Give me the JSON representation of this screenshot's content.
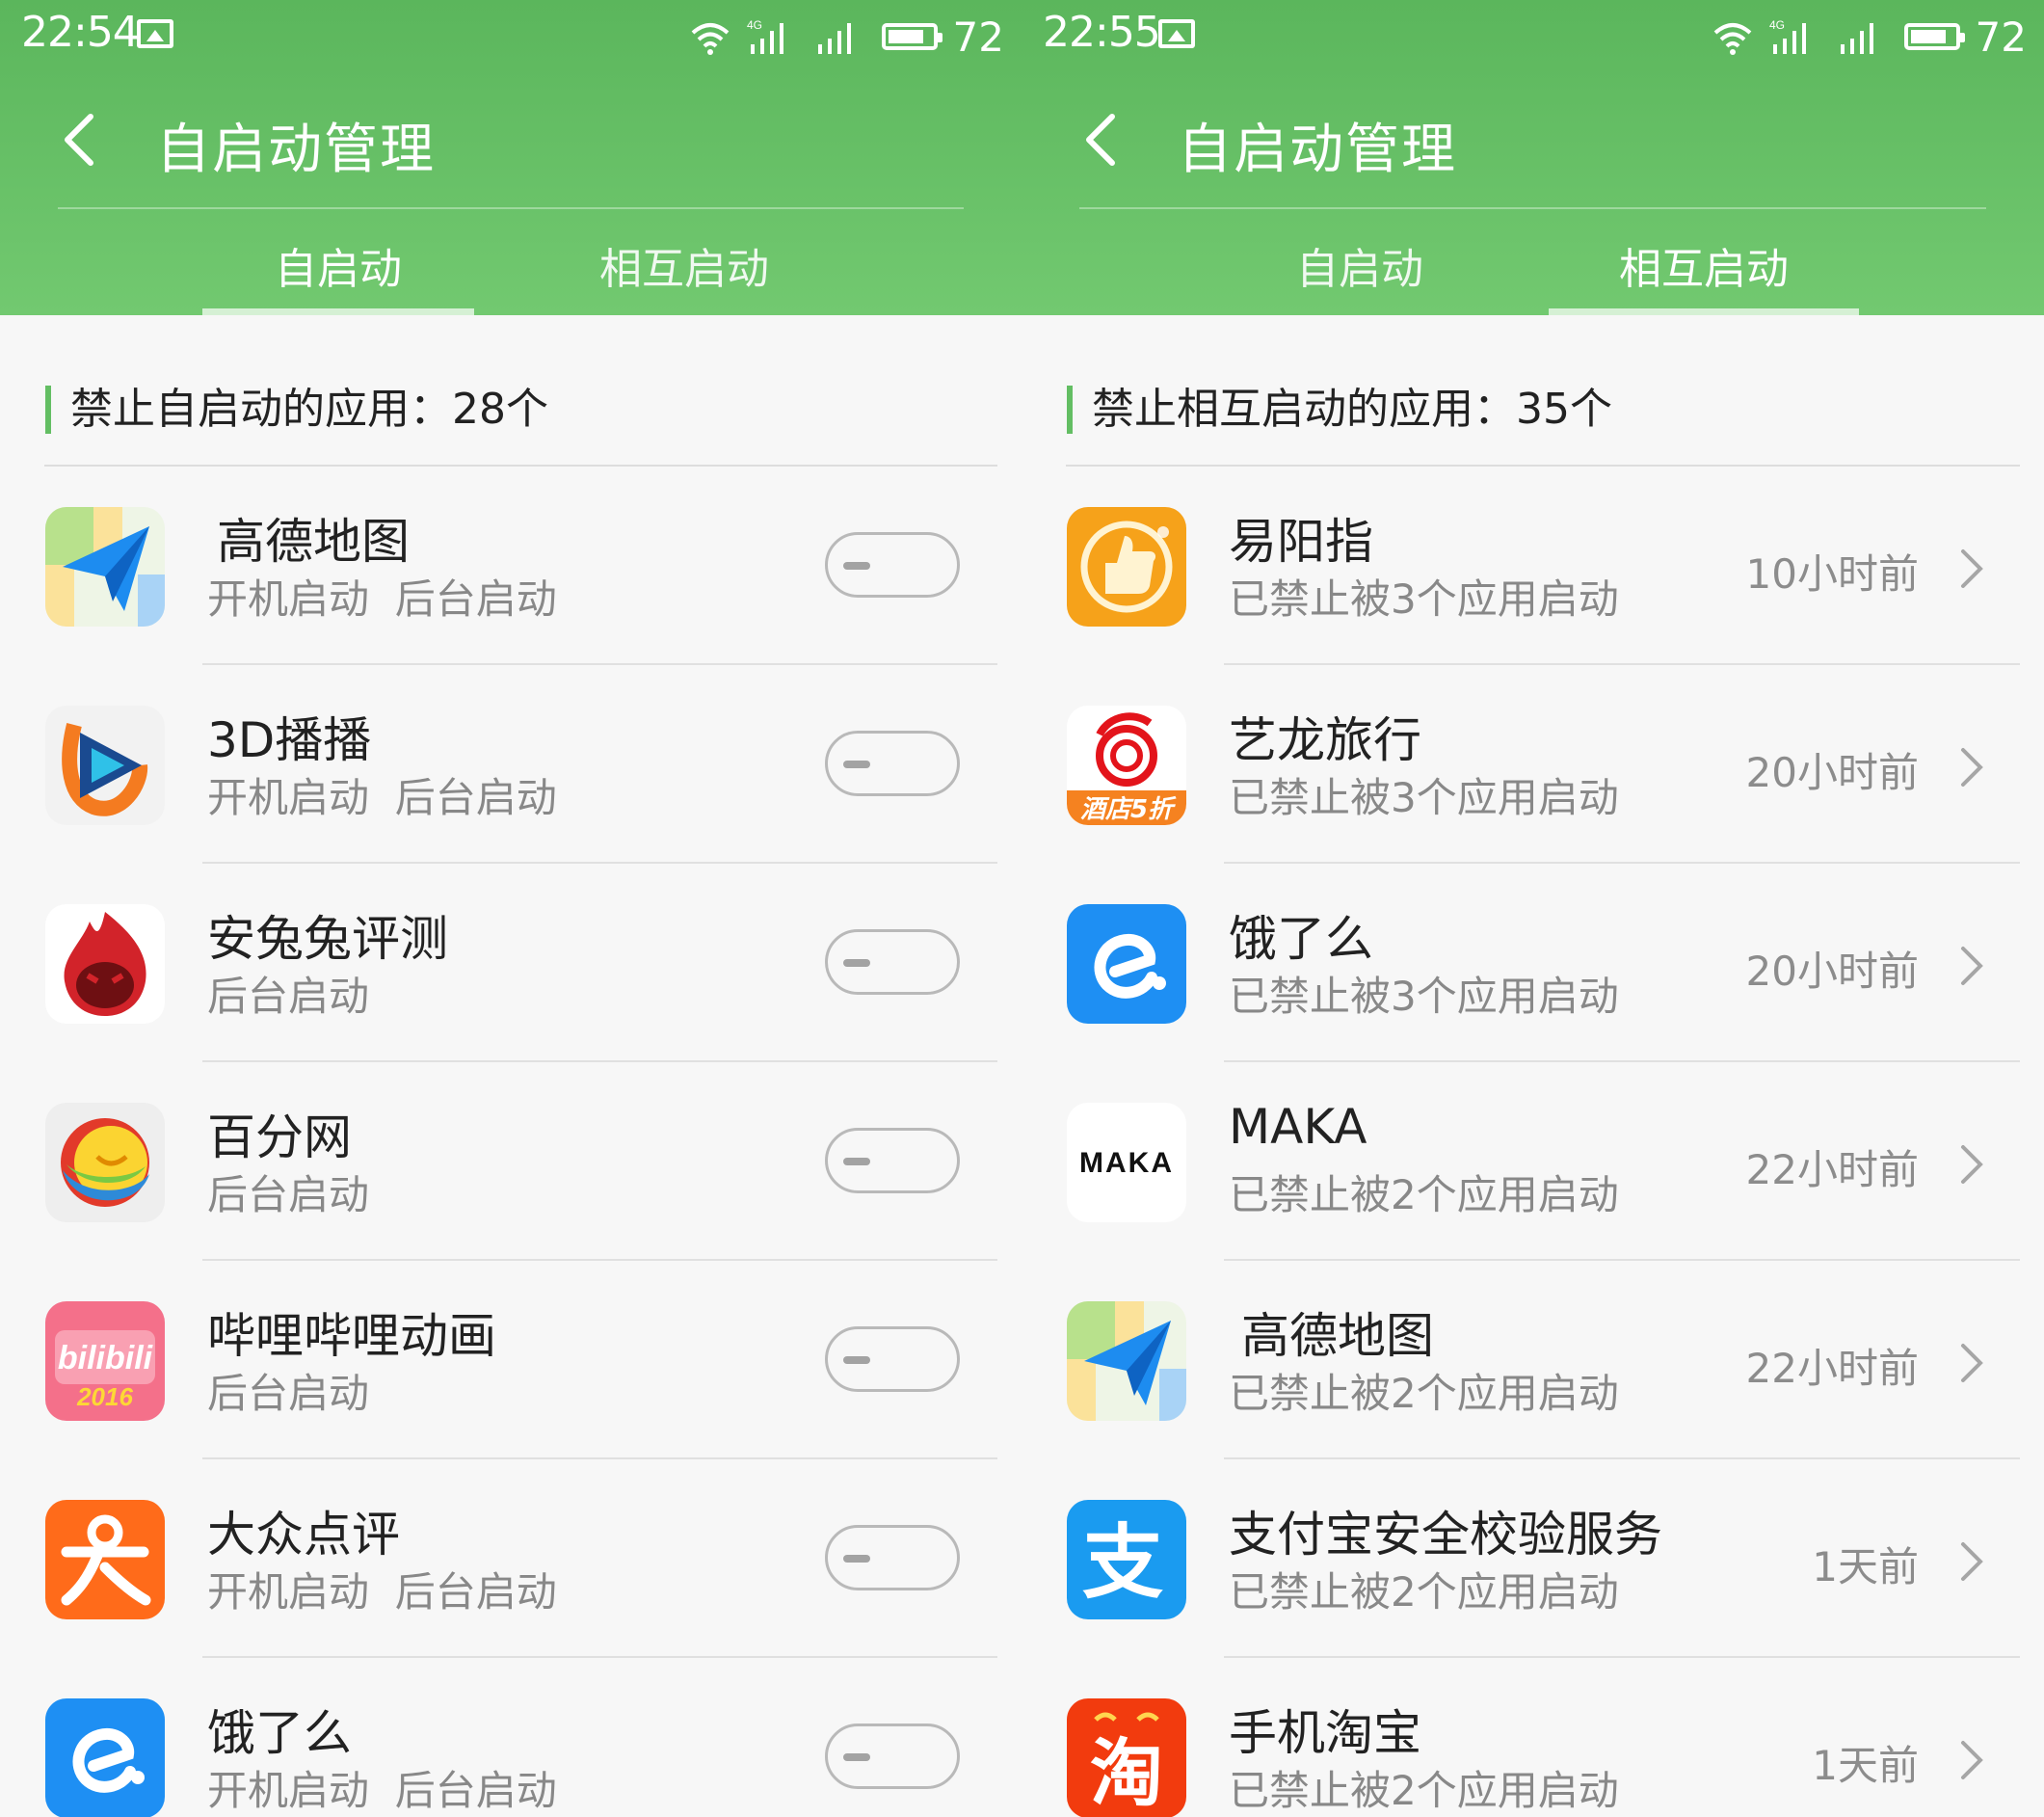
{
  "colors": {
    "header": "#67bf65",
    "accent": "#63be63",
    "toggle": "#b9b9b9"
  },
  "left": {
    "status": {
      "time": "22:54",
      "battery": "72"
    },
    "title": "自启动管理",
    "tabs": [
      "自启动",
      "相互启动"
    ],
    "active_tab": 0,
    "section": "禁止自启动的应用：28个",
    "apps": [
      {
        "name": "高德地图",
        "sub": "开机启动  后台启动",
        "icon": "amap-icon",
        "enabled": false
      },
      {
        "name": "3D播播",
        "sub": "开机启动  后台启动",
        "icon": "3dbobo-icon",
        "enabled": false
      },
      {
        "name": "安兔兔评测",
        "sub": "后台启动",
        "icon": "antutu-icon",
        "enabled": false
      },
      {
        "name": "百分网",
        "sub": "后台启动",
        "icon": "baifen-icon",
        "enabled": false
      },
      {
        "name": "哔哩哔哩动画",
        "sub": "后台启动",
        "icon": "bilibili-icon",
        "enabled": false
      },
      {
        "name": "大众点评",
        "sub": "开机启动  后台启动",
        "icon": "dianping-icon",
        "enabled": false
      },
      {
        "name": "饿了么",
        "sub": "开机启动  后台启动",
        "icon": "eleme-icon",
        "enabled": false
      }
    ]
  },
  "right": {
    "status": {
      "time": "22:55",
      "battery": "72"
    },
    "title": "自启动管理",
    "tabs": [
      "自启动",
      "相互启动"
    ],
    "active_tab": 1,
    "section": "禁止相互启动的应用：35个",
    "apps": [
      {
        "name": "易阳指",
        "sub": "已禁止被3个应用启动",
        "time": "10小时前",
        "icon": "yiyangzhi-icon"
      },
      {
        "name": "艺龙旅行",
        "sub": "已禁止被3个应用启动",
        "time": "20小时前",
        "icon": "elong-icon",
        "badge": "酒店5折"
      },
      {
        "name": "饿了么",
        "sub": "已禁止被3个应用启动",
        "time": "20小时前",
        "icon": "eleme-icon"
      },
      {
        "name": "MAKA",
        "sub": "已禁止被2个应用启动",
        "time": "22小时前",
        "icon": "maka-icon",
        "icon_text": "MAKA"
      },
      {
        "name": "高德地图",
        "sub": "已禁止被2个应用启动",
        "time": "22小时前",
        "icon": "amap-icon"
      },
      {
        "name": "支付宝安全校验服务",
        "sub": "已禁止被2个应用启动",
        "time": "1天前",
        "icon": "alipay-icon",
        "icon_text": "支"
      },
      {
        "name": "手机淘宝",
        "sub": "已禁止被2个应用启动",
        "time": "1天前",
        "icon": "taobao-icon",
        "icon_text": "淘"
      }
    ]
  }
}
